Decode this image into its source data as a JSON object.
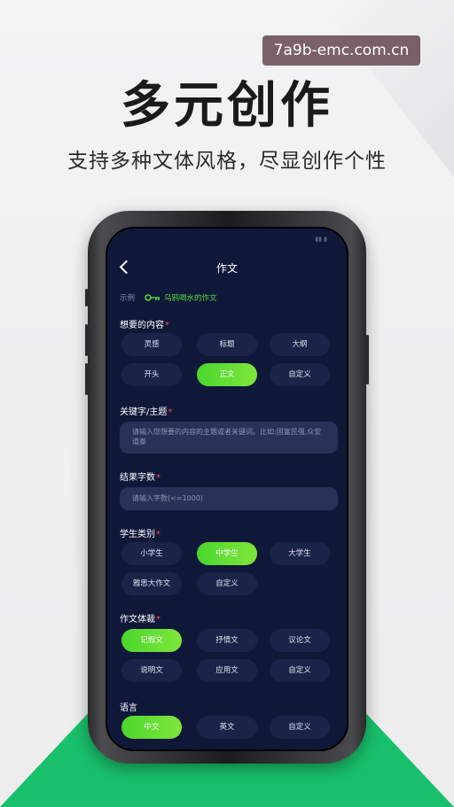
{
  "watermark": "7a9b-emc.com.cn",
  "headline": "多元创作",
  "subline": "支持多种文体风格，尽显创作个性",
  "app": {
    "nav_title": "作文",
    "example_label": "示例",
    "example_link": "乌鸦喝水的作文",
    "sections": {
      "content": {
        "label": "想要的内容",
        "required": "*",
        "options": [
          "灵感",
          "标题",
          "大纲",
          "开头",
          "正文",
          "自定义"
        ],
        "selected": "正文"
      },
      "keywords": {
        "label": "关键字/主题",
        "required": "*",
        "placeholder": "请输入您想要的内容的主题或者关键词。比如:国富民强,众安道泰"
      },
      "word_count": {
        "label": "结果字数",
        "required": "*",
        "placeholder": "请输入字数(<=1000)"
      },
      "student": {
        "label": "学生类别",
        "required": "*",
        "options": [
          "小学生",
          "中学生",
          "大学生",
          "雅思大作文",
          "自定义"
        ],
        "selected": "中学生"
      },
      "genre": {
        "label": "作文体裁",
        "required": "*",
        "options": [
          "记叙文",
          "抒情文",
          "议论文",
          "说明文",
          "应用文",
          "自定义"
        ],
        "selected": "记叙文"
      },
      "language": {
        "label": "语言",
        "options": [
          "中文",
          "英文",
          "自定义"
        ],
        "selected": "中文"
      }
    }
  },
  "colors": {
    "screen_bg": "#10183a",
    "chip_bg": "#1a2348",
    "active_green": "#4bd62e",
    "accent_green": "#19c06b",
    "required_red": "#ff4d4d"
  },
  "icons": [
    "back-chevron-icon",
    "key-icon"
  ]
}
